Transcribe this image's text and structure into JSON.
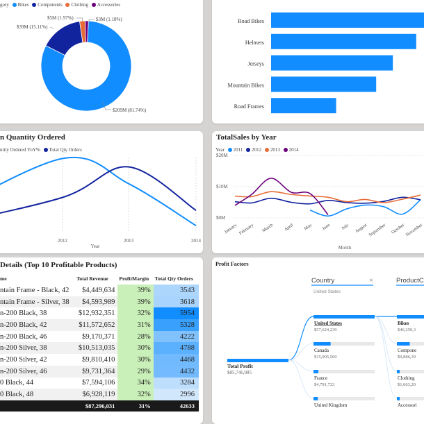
{
  "donut_card": {
    "legend_prefix": "gory",
    "legend": [
      {
        "label": "Bikes",
        "color": "#118dff"
      },
      {
        "label": "Components",
        "color": "#12239e"
      },
      {
        "label": "Clothing",
        "color": "#e66c37"
      },
      {
        "label": "Accessories",
        "color": "#6b007b"
      }
    ],
    "labels": {
      "clothing": "$5M (1.97%)",
      "accessories": "$3M (1.18%)",
      "components": "$39M (15.11%)",
      "bikes": "$209M (81.74%)"
    },
    "chart_data": {
      "type": "pie",
      "categories": [
        "Bikes",
        "Components",
        "Clothing",
        "Accessories"
      ],
      "values": [
        209,
        39,
        5,
        3
      ],
      "percent": [
        81.74,
        15.11,
        1.97,
        1.18
      ]
    }
  },
  "bar_card": {
    "chart_data": {
      "type": "bar",
      "categories": [
        "Road Bikes",
        "Helmets",
        "Jerseys",
        "Mountain Bikes",
        "Road Frames"
      ],
      "values": [
        100,
        87,
        73,
        63,
        39
      ]
    },
    "bar_color": "#118dff"
  },
  "qty_card": {
    "title": "n Quantity Ordered",
    "legend": [
      {
        "label": "ntity Ordered YoY%",
        "color": "#118dff"
      },
      {
        "label": "Total Qty Orders",
        "color": "#12239e"
      }
    ],
    "x_title": "Year",
    "chart_data": {
      "type": "line",
      "x": [
        "2011",
        "2012",
        "2013",
        "2014"
      ],
      "series": [
        {
          "name": "ntity Ordered YoY%",
          "values": [
            0.15,
            0.96,
            0.63,
            0.08
          ]
        },
        {
          "name": "Total Qty Orders",
          "values": [
            0.05,
            0.45,
            0.85,
            0.28
          ]
        }
      ],
      "xticks": [
        "2012",
        "2013",
        "2014"
      ]
    }
  },
  "sales_card": {
    "title": "TotalSales by Year",
    "legend_title": "Year",
    "legend": [
      {
        "label": "2011",
        "color": "#118dff"
      },
      {
        "label": "2012",
        "color": "#12239e"
      },
      {
        "label": "2013",
        "color": "#e66c37"
      },
      {
        "label": "2014",
        "color": "#6b007b"
      }
    ],
    "x_title": "Month",
    "chart_data": {
      "type": "line",
      "x": [
        "January",
        "February",
        "March",
        "April",
        "May",
        "June",
        "July",
        "August",
        "September",
        "October",
        "November"
      ],
      "yticks": [
        "$20M",
        "$10M",
        "$0M"
      ],
      "ylim": [
        0,
        20
      ],
      "series": [
        {
          "name": "2011",
          "values": [
            null,
            null,
            null,
            null,
            2.5,
            0.6,
            2.9,
            4.1,
            3.6,
            1.2,
            5.8
          ]
        },
        {
          "name": "2012",
          "values": [
            5.2,
            4.8,
            6.3,
            5.0,
            4.5,
            5.6,
            4.9,
            4.7,
            5.3,
            6.6,
            5.8
          ]
        },
        {
          "name": "2013",
          "values": [
            7.0,
            6.8,
            8.4,
            7.5,
            7.0,
            6.6,
            5.2,
            5.9,
            4.9,
            6.0,
            7.3
          ]
        },
        {
          "name": "2014",
          "values": [
            4.0,
            7.5,
            12.7,
            8.2,
            7.8,
            1.0,
            null,
            null,
            null,
            null,
            null
          ]
        }
      ]
    }
  },
  "table_card": {
    "title": "Details (Top 10 Profitable Products)",
    "columns": [
      "me",
      "Total Revenue",
      "ProfitMargin",
      "Total Qty Orders"
    ],
    "rows": [
      {
        "name": "ntain Frame - Black, 42",
        "revenue": "$4,449,634",
        "margin": "39%",
        "qty": "3543",
        "qty_val": 3543
      },
      {
        "name": "ntain Frame - Silver, 38",
        "revenue": "$4,593,989",
        "margin": "39%",
        "qty": "3618",
        "qty_val": 3618
      },
      {
        "name": "n-200 Black, 38",
        "revenue": "$12,932,351",
        "margin": "32%",
        "qty": "5954",
        "qty_val": 5954
      },
      {
        "name": "n-200 Black, 42",
        "revenue": "$11,572,652",
        "margin": "31%",
        "qty": "5328",
        "qty_val": 5328
      },
      {
        "name": "n-200 Black, 46",
        "revenue": "$9,170,371",
        "margin": "28%",
        "qty": "4222",
        "qty_val": 4222
      },
      {
        "name": "n-200 Silver, 38",
        "revenue": "$10,513,035",
        "margin": "30%",
        "qty": "4788",
        "qty_val": 4788
      },
      {
        "name": "n-200 Silver, 42",
        "revenue": "$9,810,410",
        "margin": "30%",
        "qty": "4468",
        "qty_val": 4468
      },
      {
        "name": "n-200 Silver, 46",
        "revenue": "$9,731,364",
        "margin": "29%",
        "qty": "4432",
        "qty_val": 4432
      },
      {
        "name": "0 Black, 44",
        "revenue": "$7,594,106",
        "margin": "34%",
        "qty": "3284",
        "qty_val": 3284
      },
      {
        "name": "0 Black, 48",
        "revenue": "$6,928,119",
        "margin": "32%",
        "qty": "2996",
        "qty_val": 2996
      }
    ],
    "total": {
      "name": "",
      "revenue": "$87,296,031",
      "margin": "31%",
      "qty": "42633"
    }
  },
  "profit_card": {
    "title": "Profit Factors",
    "root": {
      "label": "Total Profit",
      "value": "$85,746,985"
    },
    "country": {
      "header": "Country",
      "close": "×",
      "filter": "United States",
      "items": [
        {
          "label": "United States",
          "value": "$57,624,239",
          "share": 1.0
        },
        {
          "label": "Canada",
          "value": "$15,905,560",
          "share": 0.28
        },
        {
          "label": "France",
          "value": "$4,791,733",
          "share": 0.08
        },
        {
          "label": "United Kingdom",
          "value": "",
          "share": 0.07
        }
      ]
    },
    "product": {
      "header": "ProductC",
      "items": [
        {
          "label": "Bikes",
          "value": "$46,250,3",
          "share": 1.0
        },
        {
          "label": "Compone",
          "value": "$9,886,39",
          "share": 0.21
        },
        {
          "label": "Clothing",
          "value": "$1,063,20",
          "share": 0.02
        },
        {
          "label": "Accessori",
          "value": "",
          "share": 0.01
        }
      ]
    }
  }
}
